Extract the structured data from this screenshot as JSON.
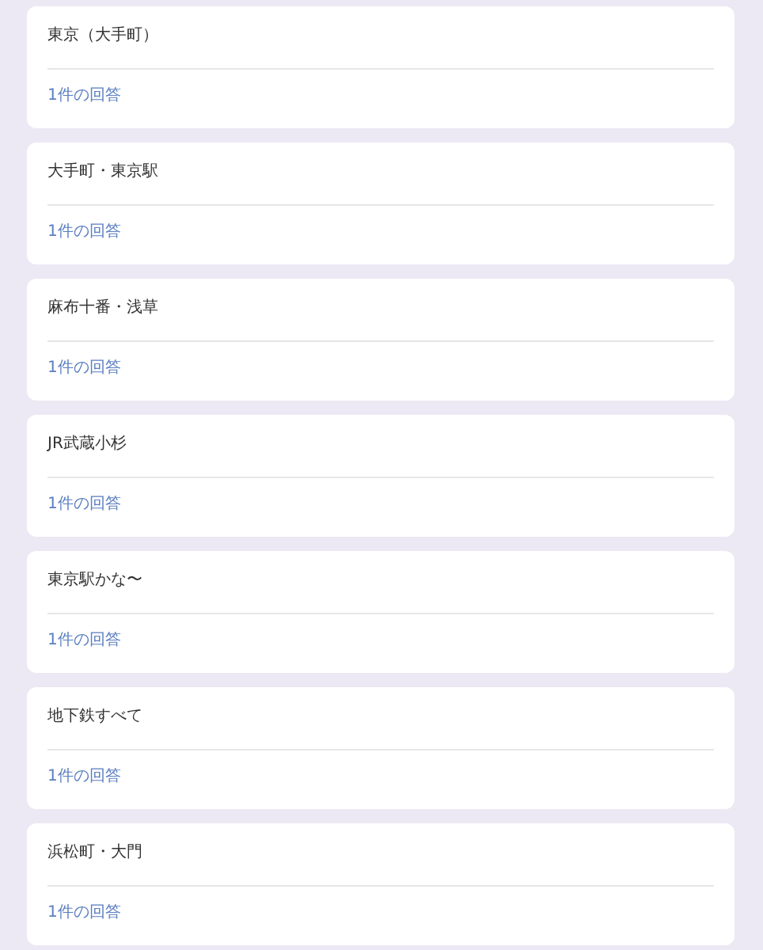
{
  "responses": [
    {
      "answer": "東京（大手町）",
      "count": "1件の回答"
    },
    {
      "answer": "大手町・東京駅",
      "count": "1件の回答"
    },
    {
      "answer": "麻布十番・浅草",
      "count": "1件の回答"
    },
    {
      "answer": "JR武蔵小杉",
      "count": "1件の回答"
    },
    {
      "answer": "東京駅かな〜",
      "count": "1件の回答"
    },
    {
      "answer": "地下鉄すべて",
      "count": "1件の回答"
    },
    {
      "answer": "浜松町・大門",
      "count": "1件の回答"
    }
  ]
}
